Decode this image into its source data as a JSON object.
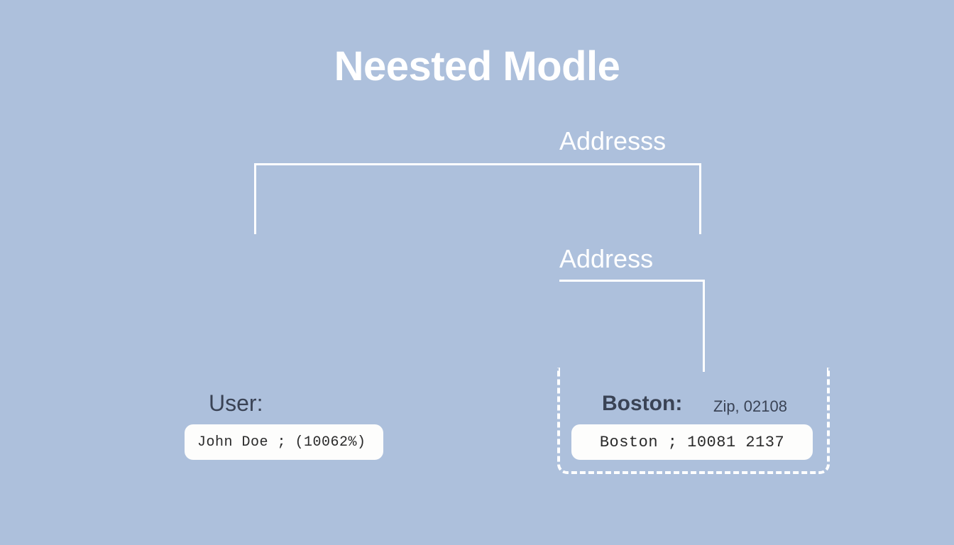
{
  "title": "Neested Modle",
  "labels": {
    "addresss": "Addresss",
    "address": "Address",
    "user": "User:",
    "boston": "Boston:",
    "zip": "Zip, 02108"
  },
  "boxes": {
    "user_value": "John Doe ; (10062%)",
    "boston_value": "Boston ; 10081 2137"
  }
}
